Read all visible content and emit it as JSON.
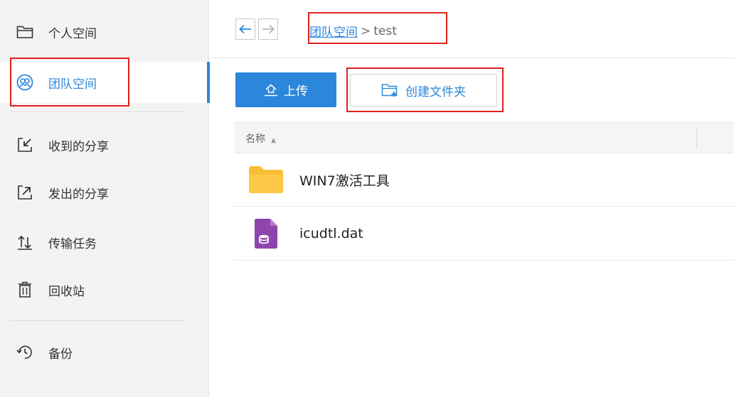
{
  "sidebar": {
    "items": [
      {
        "label": "个人空间",
        "icon": "folder-icon"
      },
      {
        "label": "团队空间",
        "icon": "team-icon",
        "active": true
      },
      {
        "label": "收到的分享",
        "icon": "received-share-icon"
      },
      {
        "label": "发出的分享",
        "icon": "sent-share-icon"
      },
      {
        "label": "传输任务",
        "icon": "transfer-icon"
      },
      {
        "label": "回收站",
        "icon": "trash-icon"
      },
      {
        "label": "备份",
        "icon": "backup-icon"
      }
    ]
  },
  "topbar": {
    "back_icon": "arrow-left-icon",
    "forward_icon": "arrow-right-icon",
    "breadcrumb": {
      "root": "团队空间",
      "separator": ">",
      "current": "test"
    }
  },
  "toolbar": {
    "upload_label": "上传",
    "create_folder_label": "创建文件夹"
  },
  "list": {
    "header_name": "名称",
    "sort_indicator": "▲",
    "files": [
      {
        "name": "WIN7激活工具",
        "type": "folder",
        "icon": "folder-icon"
      },
      {
        "name": "icudtl.dat",
        "type": "file",
        "icon": "database-file-icon"
      }
    ]
  },
  "colors": {
    "accent": "#2b87da",
    "highlight_box": "#e0201b",
    "folder": "#f9bf35",
    "dat_file": "#8e44ad"
  }
}
